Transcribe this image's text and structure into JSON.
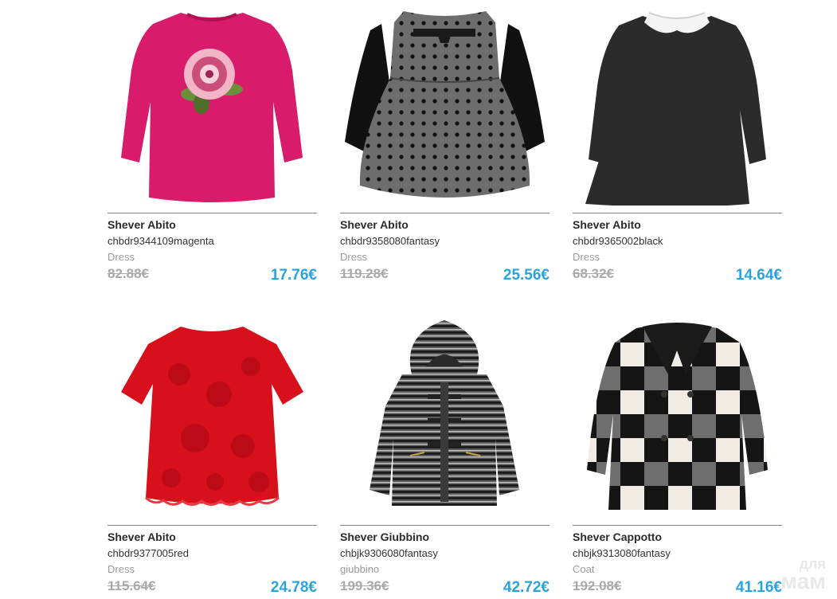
{
  "products": [
    {
      "brand": "Shever Abito",
      "sku": "chbdr9344109magenta",
      "category": "Dress",
      "old_price": "82.88€",
      "new_price": "17.76€",
      "image": "magenta-sweater-dress-image"
    },
    {
      "brand": "Shever Abito",
      "sku": "chbdr9358080fantasy",
      "category": "Dress",
      "old_price": "119.28€",
      "new_price": "25.56€",
      "image": "polka-dot-dress-image"
    },
    {
      "brand": "Shever Abito",
      "sku": "chbdr9365002black",
      "category": "Dress",
      "old_price": "68.32€",
      "new_price": "14.64€",
      "image": "black-collar-dress-image"
    },
    {
      "brand": "Shever Abito",
      "sku": "chbdr9377005red",
      "category": "Dress",
      "old_price": "115.64€",
      "new_price": "24.78€",
      "image": "red-lace-dress-image"
    },
    {
      "brand": "Shever Giubbino",
      "sku": "chbjk9306080fantasy",
      "category": "giubbino",
      "old_price": "199.36€",
      "new_price": "42.72€",
      "image": "striped-hooded-coat-image"
    },
    {
      "brand": "Shever Cappotto",
      "sku": "chbjk9313080fantasy",
      "category": "Coat",
      "old_price": "192.08€",
      "new_price": "41.16€",
      "image": "check-coat-image"
    }
  ],
  "watermark": {
    "line1": "для",
    "line2": "мам"
  }
}
